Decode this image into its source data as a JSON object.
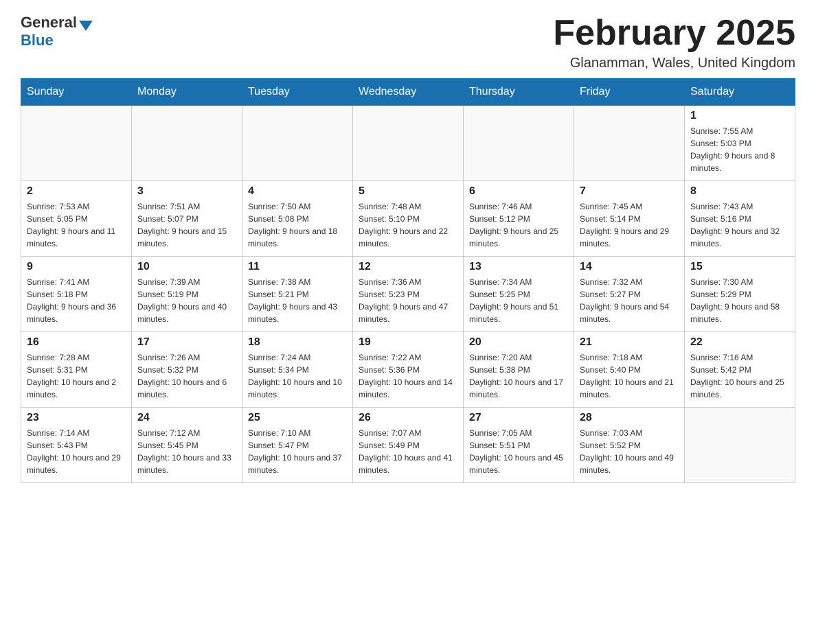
{
  "header": {
    "logo_general": "General",
    "logo_blue": "Blue",
    "month_title": "February 2025",
    "location": "Glanamman, Wales, United Kingdom"
  },
  "weekdays": [
    "Sunday",
    "Monday",
    "Tuesday",
    "Wednesday",
    "Thursday",
    "Friday",
    "Saturday"
  ],
  "weeks": [
    [
      {
        "day": "",
        "info": ""
      },
      {
        "day": "",
        "info": ""
      },
      {
        "day": "",
        "info": ""
      },
      {
        "day": "",
        "info": ""
      },
      {
        "day": "",
        "info": ""
      },
      {
        "day": "",
        "info": ""
      },
      {
        "day": "1",
        "info": "Sunrise: 7:55 AM\nSunset: 5:03 PM\nDaylight: 9 hours and 8 minutes."
      }
    ],
    [
      {
        "day": "2",
        "info": "Sunrise: 7:53 AM\nSunset: 5:05 PM\nDaylight: 9 hours and 11 minutes."
      },
      {
        "day": "3",
        "info": "Sunrise: 7:51 AM\nSunset: 5:07 PM\nDaylight: 9 hours and 15 minutes."
      },
      {
        "day": "4",
        "info": "Sunrise: 7:50 AM\nSunset: 5:08 PM\nDaylight: 9 hours and 18 minutes."
      },
      {
        "day": "5",
        "info": "Sunrise: 7:48 AM\nSunset: 5:10 PM\nDaylight: 9 hours and 22 minutes."
      },
      {
        "day": "6",
        "info": "Sunrise: 7:46 AM\nSunset: 5:12 PM\nDaylight: 9 hours and 25 minutes."
      },
      {
        "day": "7",
        "info": "Sunrise: 7:45 AM\nSunset: 5:14 PM\nDaylight: 9 hours and 29 minutes."
      },
      {
        "day": "8",
        "info": "Sunrise: 7:43 AM\nSunset: 5:16 PM\nDaylight: 9 hours and 32 minutes."
      }
    ],
    [
      {
        "day": "9",
        "info": "Sunrise: 7:41 AM\nSunset: 5:18 PM\nDaylight: 9 hours and 36 minutes."
      },
      {
        "day": "10",
        "info": "Sunrise: 7:39 AM\nSunset: 5:19 PM\nDaylight: 9 hours and 40 minutes."
      },
      {
        "day": "11",
        "info": "Sunrise: 7:38 AM\nSunset: 5:21 PM\nDaylight: 9 hours and 43 minutes."
      },
      {
        "day": "12",
        "info": "Sunrise: 7:36 AM\nSunset: 5:23 PM\nDaylight: 9 hours and 47 minutes."
      },
      {
        "day": "13",
        "info": "Sunrise: 7:34 AM\nSunset: 5:25 PM\nDaylight: 9 hours and 51 minutes."
      },
      {
        "day": "14",
        "info": "Sunrise: 7:32 AM\nSunset: 5:27 PM\nDaylight: 9 hours and 54 minutes."
      },
      {
        "day": "15",
        "info": "Sunrise: 7:30 AM\nSunset: 5:29 PM\nDaylight: 9 hours and 58 minutes."
      }
    ],
    [
      {
        "day": "16",
        "info": "Sunrise: 7:28 AM\nSunset: 5:31 PM\nDaylight: 10 hours and 2 minutes."
      },
      {
        "day": "17",
        "info": "Sunrise: 7:26 AM\nSunset: 5:32 PM\nDaylight: 10 hours and 6 minutes."
      },
      {
        "day": "18",
        "info": "Sunrise: 7:24 AM\nSunset: 5:34 PM\nDaylight: 10 hours and 10 minutes."
      },
      {
        "day": "19",
        "info": "Sunrise: 7:22 AM\nSunset: 5:36 PM\nDaylight: 10 hours and 14 minutes."
      },
      {
        "day": "20",
        "info": "Sunrise: 7:20 AM\nSunset: 5:38 PM\nDaylight: 10 hours and 17 minutes."
      },
      {
        "day": "21",
        "info": "Sunrise: 7:18 AM\nSunset: 5:40 PM\nDaylight: 10 hours and 21 minutes."
      },
      {
        "day": "22",
        "info": "Sunrise: 7:16 AM\nSunset: 5:42 PM\nDaylight: 10 hours and 25 minutes."
      }
    ],
    [
      {
        "day": "23",
        "info": "Sunrise: 7:14 AM\nSunset: 5:43 PM\nDaylight: 10 hours and 29 minutes."
      },
      {
        "day": "24",
        "info": "Sunrise: 7:12 AM\nSunset: 5:45 PM\nDaylight: 10 hours and 33 minutes."
      },
      {
        "day": "25",
        "info": "Sunrise: 7:10 AM\nSunset: 5:47 PM\nDaylight: 10 hours and 37 minutes."
      },
      {
        "day": "26",
        "info": "Sunrise: 7:07 AM\nSunset: 5:49 PM\nDaylight: 10 hours and 41 minutes."
      },
      {
        "day": "27",
        "info": "Sunrise: 7:05 AM\nSunset: 5:51 PM\nDaylight: 10 hours and 45 minutes."
      },
      {
        "day": "28",
        "info": "Sunrise: 7:03 AM\nSunset: 5:52 PM\nDaylight: 10 hours and 49 minutes."
      },
      {
        "day": "",
        "info": ""
      }
    ]
  ]
}
